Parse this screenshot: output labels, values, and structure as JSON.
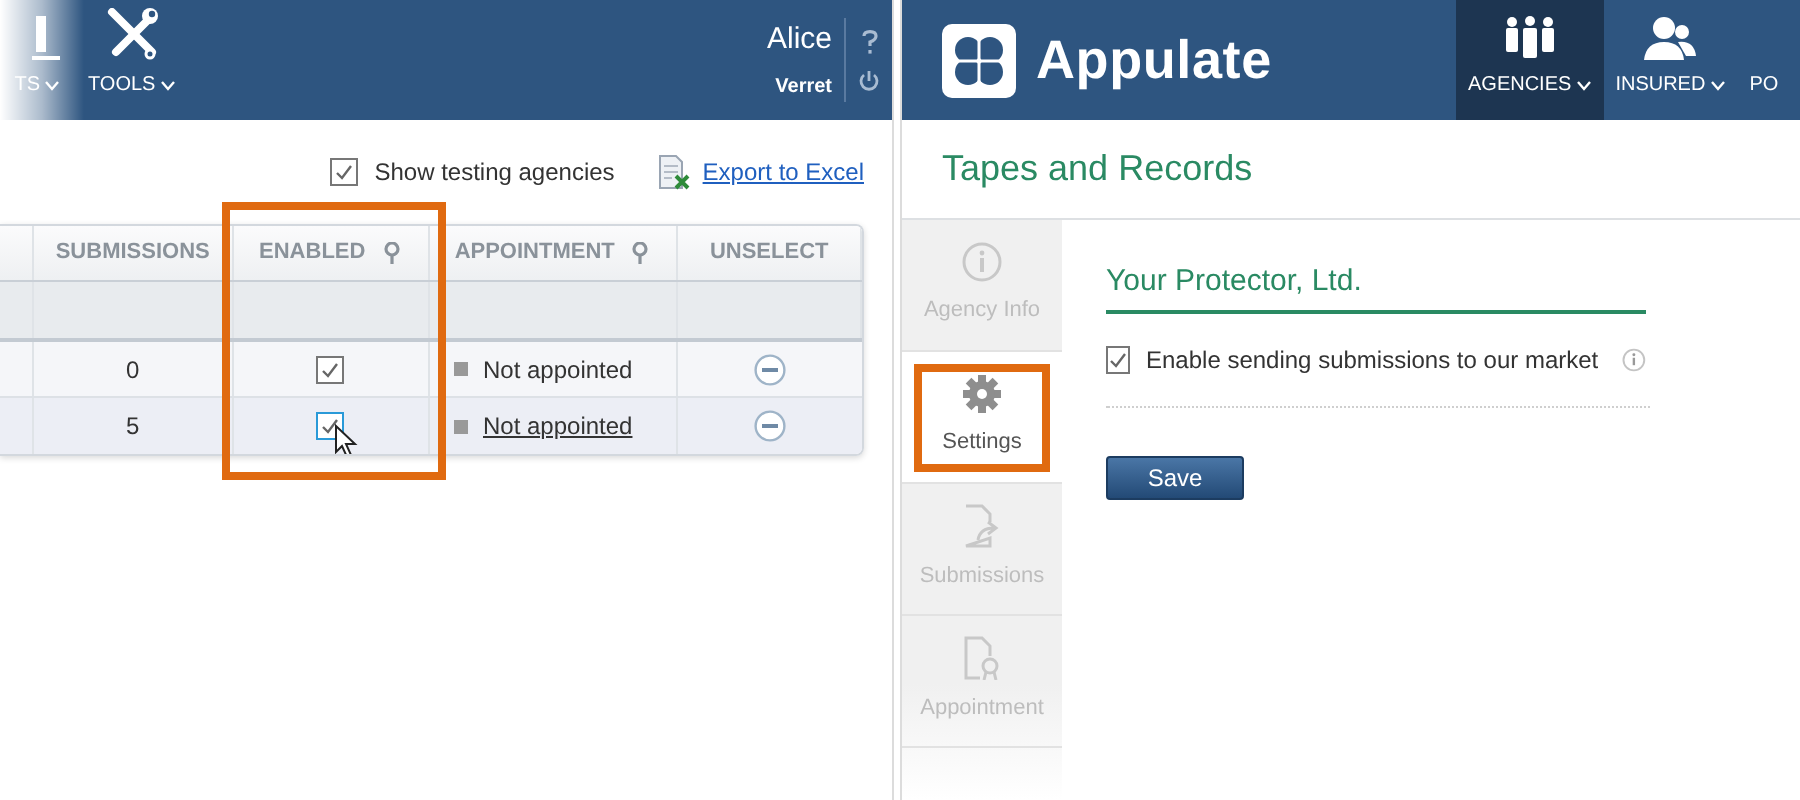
{
  "left_panel": {
    "header": {
      "nav_items": [
        {
          "label": "TS"
        },
        {
          "label": "TOOLS"
        }
      ],
      "user": {
        "first_name": "Alice",
        "last_name": "Verret"
      }
    },
    "toolbar": {
      "show_testing": {
        "label": "Show testing agencies",
        "checked": true
      },
      "export_link": "Export to Excel"
    },
    "table": {
      "columns": [
        {
          "label": "SUBMISSIONS",
          "filter": false,
          "highlighted": false
        },
        {
          "label": "ENABLED",
          "filter": true,
          "highlighted": true
        },
        {
          "label": "APPOINTMENT",
          "filter": true,
          "highlighted": false
        },
        {
          "label": "UNSELECT",
          "filter": false,
          "highlighted": false
        }
      ],
      "rows": [
        {
          "submissions": "0",
          "enabled": true,
          "hovered": false,
          "appointment": "Not appointed",
          "appointment_link": false
        },
        {
          "submissions": "5",
          "enabled": true,
          "hovered": true,
          "appointment": "Not appointed",
          "appointment_link": true
        }
      ]
    }
  },
  "right_panel": {
    "header": {
      "brand": "Appulate",
      "nav_items": [
        {
          "label": "AGENCIES",
          "selected": true
        },
        {
          "label": "INSURED",
          "selected": false
        },
        {
          "label": "PO",
          "selected": false
        }
      ]
    },
    "page_title": "Tapes and Records",
    "side_tabs": [
      {
        "label": "Agency Info",
        "selected": false,
        "highlighted": false
      },
      {
        "label": "Settings",
        "selected": true,
        "highlighted": true
      },
      {
        "label": "Submissions",
        "selected": false,
        "highlighted": false
      },
      {
        "label": "Appointment",
        "selected": false,
        "highlighted": false
      }
    ],
    "agency_name": "Your Protector, Ltd.",
    "enable_sending": {
      "label": "Enable sending submissions to our market",
      "checked": true
    },
    "save_button": "Save"
  }
}
